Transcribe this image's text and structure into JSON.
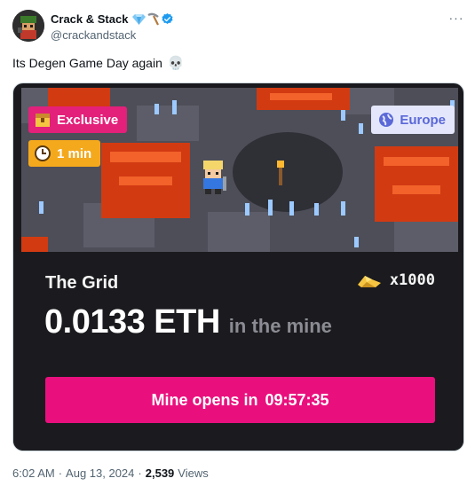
{
  "post": {
    "author_name": "Crack & Stack",
    "author_handle": "@crackandstack",
    "more_label": "···",
    "text": "Its Degen Game Day again",
    "text_emoji": "💀"
  },
  "card": {
    "badges": {
      "exclusive": "Exclusive",
      "duration": "1 min",
      "region": "Europe"
    },
    "game_name": "The Grid",
    "multiplier": "x1000",
    "prize_amount": "0.0133 ETH",
    "prize_suffix": "in the mine",
    "cta_prefix": "Mine opens in",
    "cta_timer": "09:57:35"
  },
  "meta": {
    "time": "6:02 AM",
    "date": "Aug 13, 2024",
    "views_count": "2,539",
    "views_label": "Views"
  },
  "colors": {
    "exclusive_badge": "#e3207a",
    "duration_badge": "#f4a91d",
    "region_badge_bg": "#e4e7fb",
    "region_badge_text": "#5a68d8",
    "cta": "#e9107d",
    "card_bg": "#1b1b1f",
    "verified": "#1d9bf0"
  },
  "icons": {
    "avatar": "pixel-character-avatar",
    "diamond": "diamond-emoji",
    "pickaxe": "pickaxe-emoji",
    "verified": "verified-badge-icon",
    "skull": "skull-emoji",
    "exclusive": "treasure-chest-icon",
    "duration": "clock-icon",
    "region": "globe-icon",
    "multiplier": "gold-nugget-icon"
  }
}
